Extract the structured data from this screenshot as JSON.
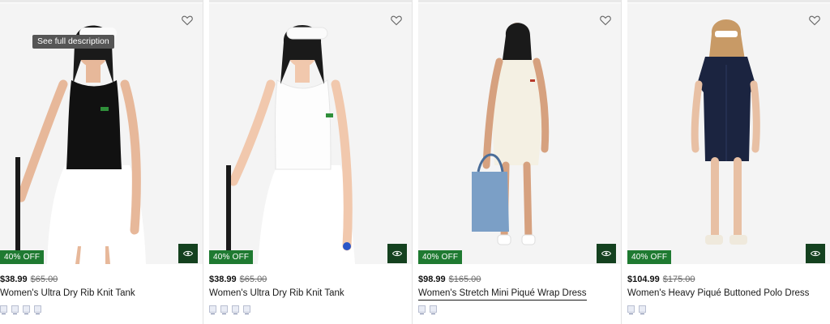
{
  "tooltip": "See full description",
  "products": [
    {
      "discount": "40% OFF",
      "price": "$38.99",
      "original_price": "$65.00",
      "name": "Women's Ultra Dry Rib Knit Tank",
      "swatch_count": 4
    },
    {
      "discount": "40% OFF",
      "price": "$38.99",
      "original_price": "$65.00",
      "name": "Women's Ultra Dry Rib Knit Tank",
      "swatch_count": 4
    },
    {
      "discount": "40% OFF",
      "price": "$98.99",
      "original_price": "$165.00",
      "name": "Women's Stretch Mini Piqué Wrap Dress",
      "swatch_count": 2
    },
    {
      "discount": "40% OFF",
      "price": "$104.99",
      "original_price": "$175.00",
      "name": "Women's Heavy Piqué Buttoned Polo Dress",
      "swatch_count": 2
    }
  ],
  "icons": {
    "wishlist": "heart-icon",
    "quick_view": "eye-icon"
  },
  "colors": {
    "badge": "#1f7a31",
    "quick_view": "#14411f"
  }
}
